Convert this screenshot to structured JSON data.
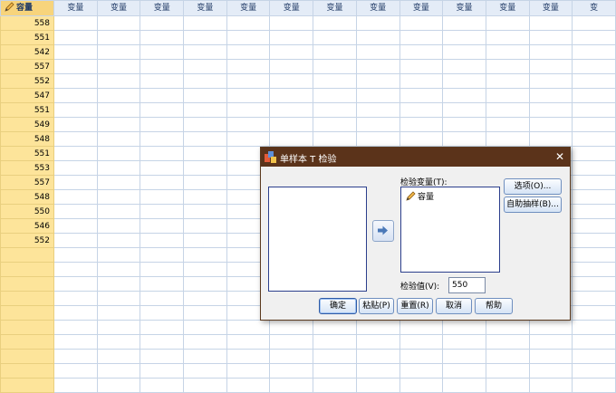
{
  "grid": {
    "first_column": {
      "name": "容量",
      "values": [
        "558",
        "551",
        "542",
        "557",
        "552",
        "547",
        "551",
        "549",
        "548",
        "551",
        "553",
        "557",
        "548",
        "550",
        "546",
        "552"
      ]
    },
    "other_columns": [
      "变量",
      "变量",
      "变量",
      "变量",
      "变量",
      "变量",
      "变量",
      "变量",
      "变量",
      "变量",
      "变量",
      "变量",
      "变"
    ],
    "empty_rows": 10
  },
  "dialog": {
    "title": "单样本 T 检验",
    "test_variables_label": "检验变量(T):",
    "test_variables": [
      "容量"
    ],
    "test_value_label": "检验值(V):",
    "test_value": "550",
    "buttons": {
      "options": "选项(O)...",
      "bootstrap": "自助抽样(B)...",
      "ok": "确定",
      "paste": "粘贴(P)",
      "reset": "重置(R)",
      "cancel": "取消",
      "help": "帮助"
    }
  },
  "colors": {
    "titlebar": "#5b331a",
    "first_column": "#fde49a",
    "header": "#e4ecf7"
  }
}
